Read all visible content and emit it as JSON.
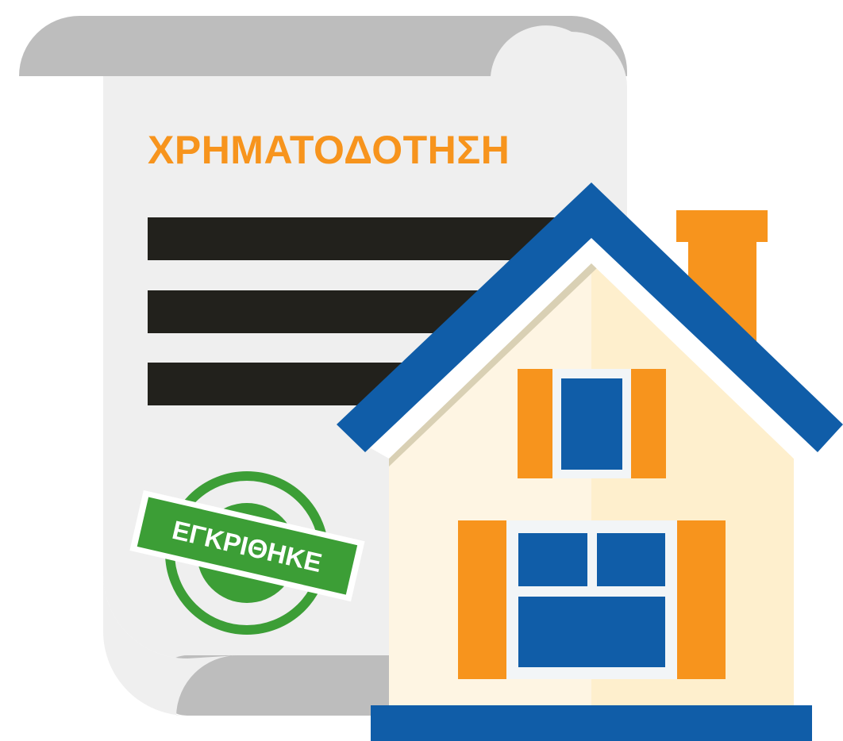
{
  "document": {
    "title": "ΧΡΗΜΑΤΟΔΟΤΗΣΗ"
  },
  "stamp": {
    "label": "ΕΓΚΡΙΘΗΚΕ"
  },
  "colors": {
    "orange": "#F7941D",
    "blue": "#105DA8",
    "green": "#3C9E36",
    "paper": "#EFEFEF",
    "scroll_grey": "#BDBDBD",
    "text_bar": "#22211C",
    "house_wall_light": "#FEF5E3",
    "house_wall_shade": "#FEEFCD"
  }
}
